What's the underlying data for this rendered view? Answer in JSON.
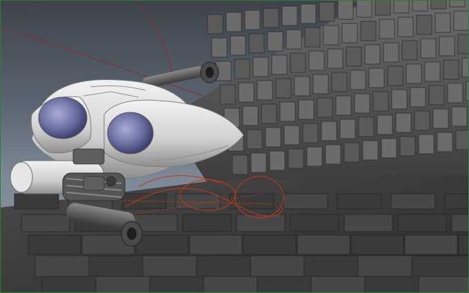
{
  "viewport": {
    "kind": "3d-modeling-perspective-viewport",
    "panel_border_color": "#2f7a3c",
    "background_gradient": [
      "#3e434a",
      "#8e99a6"
    ]
  },
  "scene": {
    "subject": "spaceship-model",
    "environment": "paneled-trench-wall",
    "selected_curves_color": "#c0391b",
    "view_guide_line_color": "#8a2f2f"
  }
}
